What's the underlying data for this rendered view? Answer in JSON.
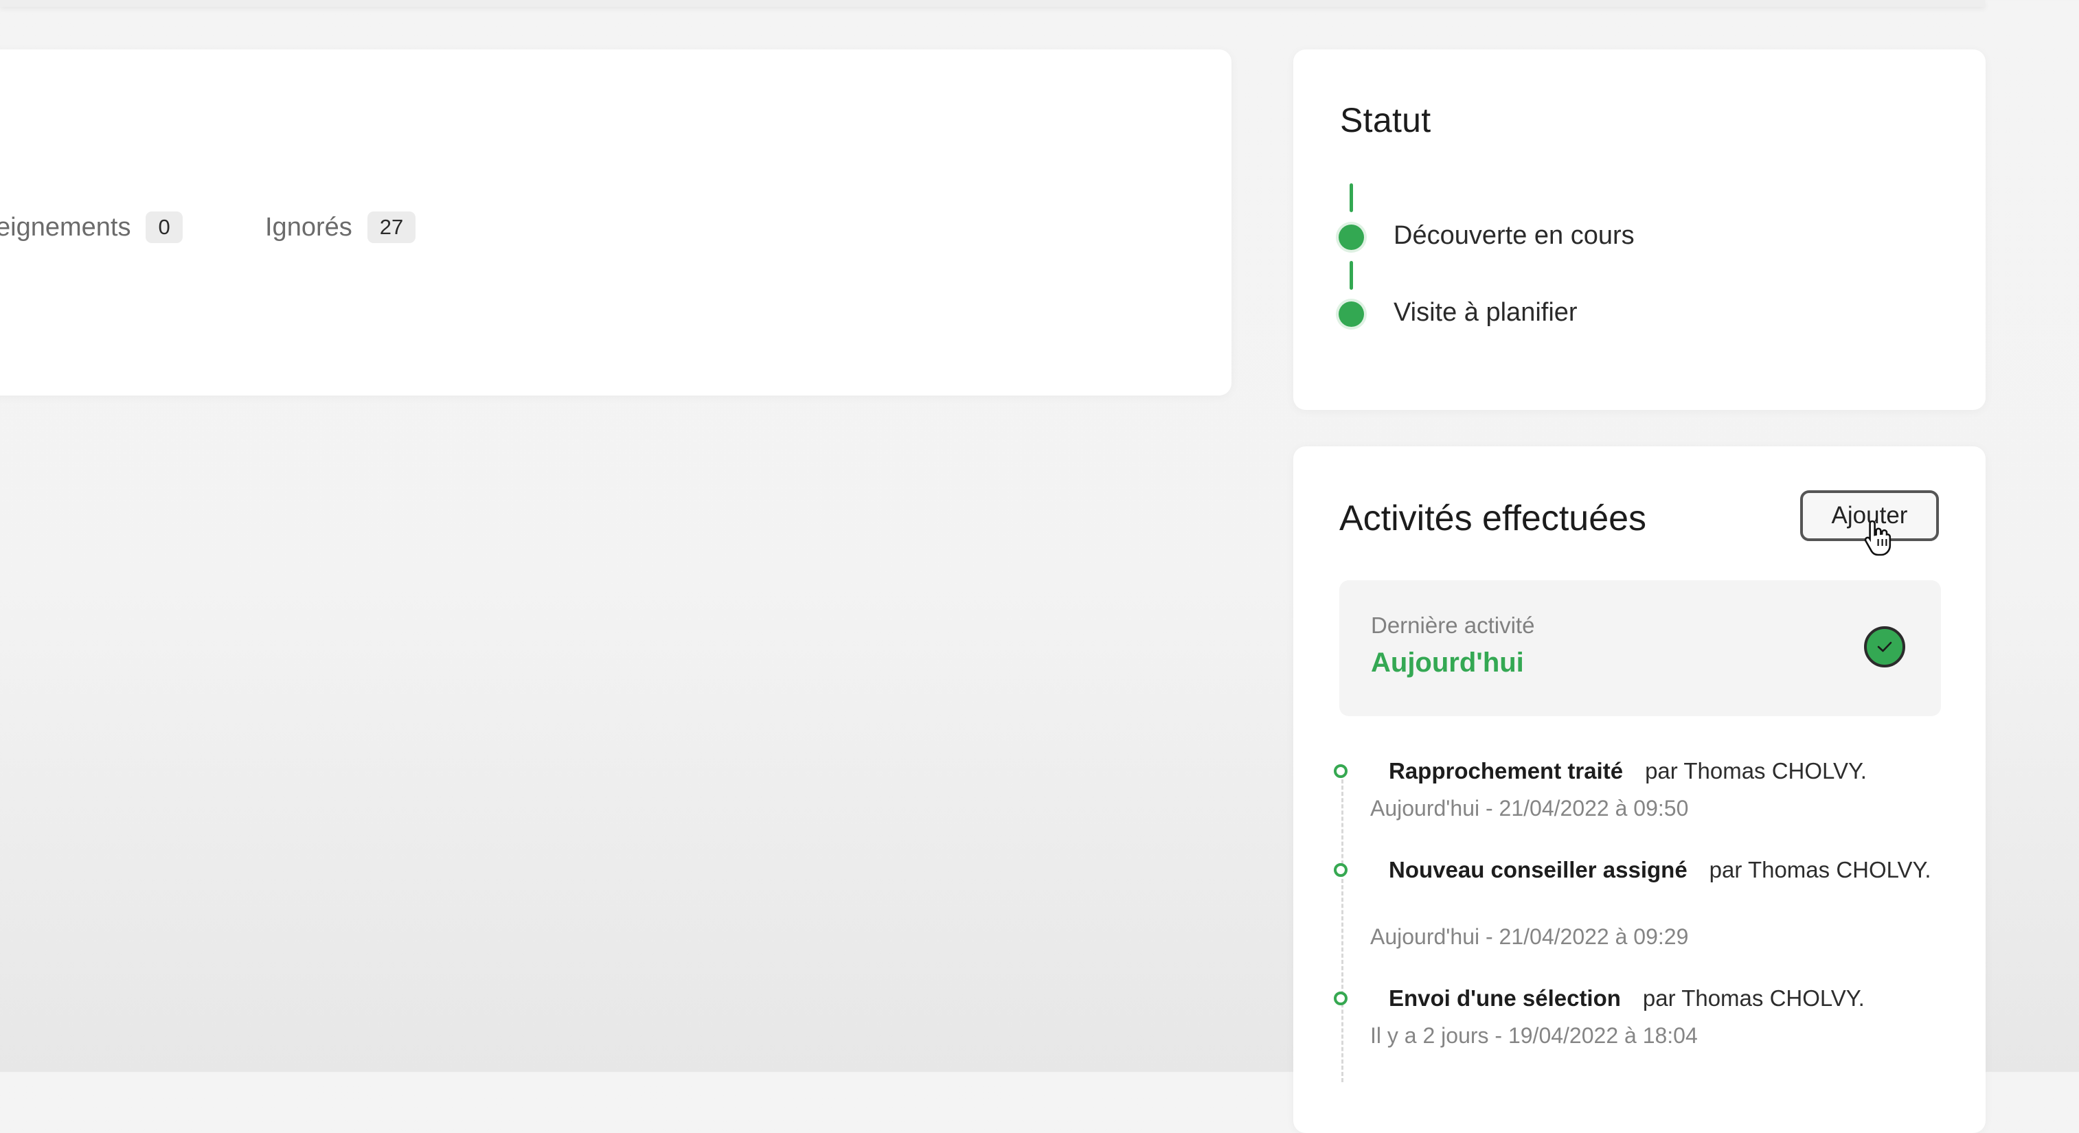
{
  "filters": [
    {
      "label": "eignements",
      "count": "0"
    },
    {
      "label": "Ignorés",
      "count": "27"
    }
  ],
  "status": {
    "title": "Statut",
    "steps": [
      {
        "label": "Découverte en cours"
      },
      {
        "label": "Visite à planifier"
      }
    ]
  },
  "activities": {
    "title": "Activités effectuées",
    "add_label": "Ajouter",
    "last_activity": {
      "label": "Dernière activité",
      "value": "Aujourd'hui"
    },
    "items": [
      {
        "event": "Rapprochement traité",
        "by": "par Thomas CHOLVY.",
        "date": "Aujourd'hui - 21/04/2022 à 09:50"
      },
      {
        "event": "Nouveau conseiller assigné",
        "by": "par Thomas CHOLVY.",
        "date": "Aujourd'hui - 21/04/2022 à 09:29"
      },
      {
        "event": "Envoi d'une sélection",
        "by": "par Thomas CHOLVY.",
        "date": "Il y a 2 jours - 19/04/2022 à 18:04"
      }
    ]
  },
  "colors": {
    "accent_green": "#34a853",
    "muted_text": "#858585",
    "card_bg": "#ffffff"
  },
  "icons": {
    "status_dot": "filled-circle",
    "last_activity": "check-circle-icon",
    "timeline": "hollow-circle",
    "cursor": "hand-pointer-icon"
  }
}
